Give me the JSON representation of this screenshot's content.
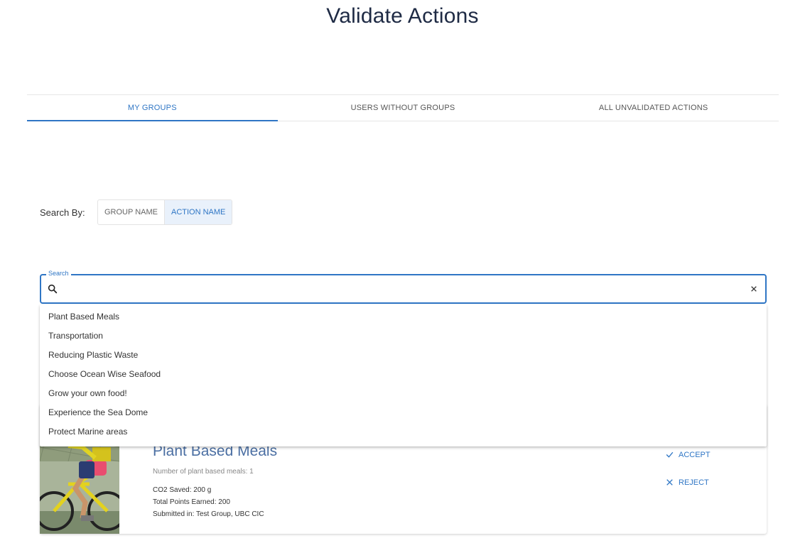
{
  "page": {
    "title": "Validate Actions"
  },
  "tabs": [
    {
      "label": "MY GROUPS",
      "active": true
    },
    {
      "label": "USERS WITHOUT GROUPS",
      "active": false
    },
    {
      "label": "ALL UNVALIDATED ACTIONS",
      "active": false
    }
  ],
  "search_by": {
    "label": "Search By:",
    "options": [
      {
        "label": "GROUP NAME",
        "selected": false
      },
      {
        "label": "ACTION NAME",
        "selected": true
      }
    ]
  },
  "search": {
    "label": "Search",
    "value": "",
    "placeholder": "",
    "icon": "search-icon",
    "clear_icon": "close-icon"
  },
  "dropdown": {
    "options": [
      "Plant Based Meals",
      "Transportation",
      "Reducing Plastic Waste",
      "Choose Ocean Wise Seafood",
      "Grow your own food!",
      "Experience the Sea Dome",
      "Protect Marine areas"
    ]
  },
  "card": {
    "title": "Plant Based Meals",
    "subtext": "Number of plant based meals: 1",
    "co2": "CO2 Saved: 200 g",
    "points": "Total Points Earned: 200",
    "submitted": "Submitted in: Test Group, UBC CIC",
    "accept_label": "ACCEPT",
    "reject_label": "REJECT"
  },
  "colors": {
    "accent": "#2f76c5",
    "title": "#1e2a44",
    "card_title": "#4b6fa3"
  }
}
